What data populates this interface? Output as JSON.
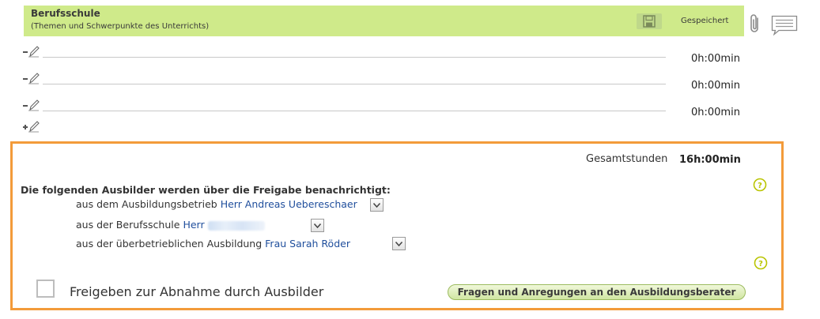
{
  "header": {
    "title": "Berufsschule",
    "subtitle": "(Themen und Schwerpunkte des Unterrichts)",
    "save_status": "Gespeichert"
  },
  "rows": [
    {
      "time": "0h:00min"
    },
    {
      "time": "0h:00min"
    },
    {
      "time": "0h:00min"
    }
  ],
  "panel": {
    "total_label": "Gesamtstunden",
    "total_value": "16h:00min",
    "notify_heading": "Die folgenden Ausbilder werden über die Freigabe benachrichtigt:",
    "trainers": [
      {
        "label": "aus dem Ausbildungsbetrieb",
        "name": "Herr Andreas Uebereschaer"
      },
      {
        "label": "aus der Berufsschule",
        "name": "Herr"
      },
      {
        "label": "aus der überbetrieblichen Ausbildung",
        "name": "Frau Sarah Röder"
      }
    ],
    "release_label": "Freigeben zur Abnahme durch Ausbilder",
    "advisor_button": "Fragen und Anregungen an den Ausbildungsberater"
  },
  "colors": {
    "header_bg": "#cfea8a",
    "panel_border": "#f39b3a",
    "link_blue": "#1f4e9c",
    "help_green": "#b9c400"
  },
  "icons": [
    "save-icon",
    "paperclip-icon",
    "comment-icon",
    "minus-edit-icon",
    "plus-edit-icon",
    "help-icon",
    "chevron-down-icon"
  ]
}
